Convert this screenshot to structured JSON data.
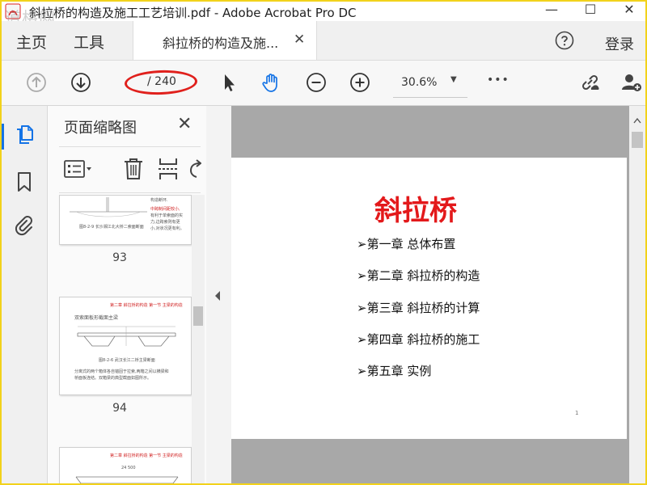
{
  "window": {
    "title": "斜拉桥的构造及施工工艺培训.pdf - Adobe Acrobat Pro DC",
    "watermark": "道格网",
    "minimize_glyph": "—",
    "maximize_glyph": "☐",
    "close_glyph": "✕"
  },
  "tabs": {
    "home": "主页",
    "tools": "工具",
    "document": "斜拉桥的构造及施...",
    "close_glyph": "✕",
    "login": "登录"
  },
  "toolbar": {
    "current_page": "",
    "total_pages": "/ 240",
    "zoom": "30.6%",
    "more_glyph": "•••",
    "zoom_arrow": "▼"
  },
  "thumbnails_panel": {
    "title": "页面缩略图",
    "close_glyph": "✕",
    "pages": [
      {
        "number": "93",
        "lines": [
          "构造断环.",
          "中跨制间距较小,",
          "有利于单索面的实",
          "力,边跨索则有更",
          "小,对状况更有利。"
        ],
        "caption": "图8-2-9 长沙湘江北大桥二索面断面"
      },
      {
        "number": "94",
        "header": "第二章 斜拉桥的构造 第一节 主梁的构造",
        "heading": "双索面板形截面主梁",
        "caption": "图8-2-6 武汉长江二桥主梁断面",
        "lines": [
          "分离式的两个箱体各自锚固于拉索,两箱之间以横梁和",
          "桥面板连结。双箱梁的典型截面如图所示。"
        ]
      },
      {
        "number": "",
        "header": "第二章 斜拉桥的构造 第一节 主梁的构造",
        "dim": "24 500"
      }
    ]
  },
  "page_content": {
    "title": "斜拉桥",
    "toc": [
      "➢第一章 总体布置",
      "➢第二章 斜拉桥的构造",
      "➢第三章 斜拉桥的计算",
      "➢第四章 斜拉桥的施工",
      "➢第五章 实例"
    ],
    "page_footer": "1"
  },
  "colors": {
    "accent_blue": "#1473e6",
    "title_red": "#e3191b",
    "annotation_red": "#e0201c",
    "border_yellow": "#f2d21b"
  },
  "icons": {
    "app": "acrobat-app-icon",
    "help": "help-circle-icon",
    "prev_page": "arrow-up-circle-icon",
    "next_page": "arrow-down-circle-icon",
    "select": "cursor-arrow-icon",
    "hand": "hand-tool-icon",
    "zoom_out": "zoom-out-icon",
    "zoom_in": "zoom-in-icon",
    "link_share": "link-share-icon",
    "add_user": "add-user-icon",
    "page_thumbnails": "page-thumbnails-icon",
    "bookmarks": "bookmark-icon",
    "attachments": "paperclip-icon",
    "options": "thumbnail-options-icon",
    "delete": "trash-icon",
    "insert": "insert-page-icon",
    "rotate": "rotate-icon",
    "collapse": "collapse-left-icon"
  }
}
